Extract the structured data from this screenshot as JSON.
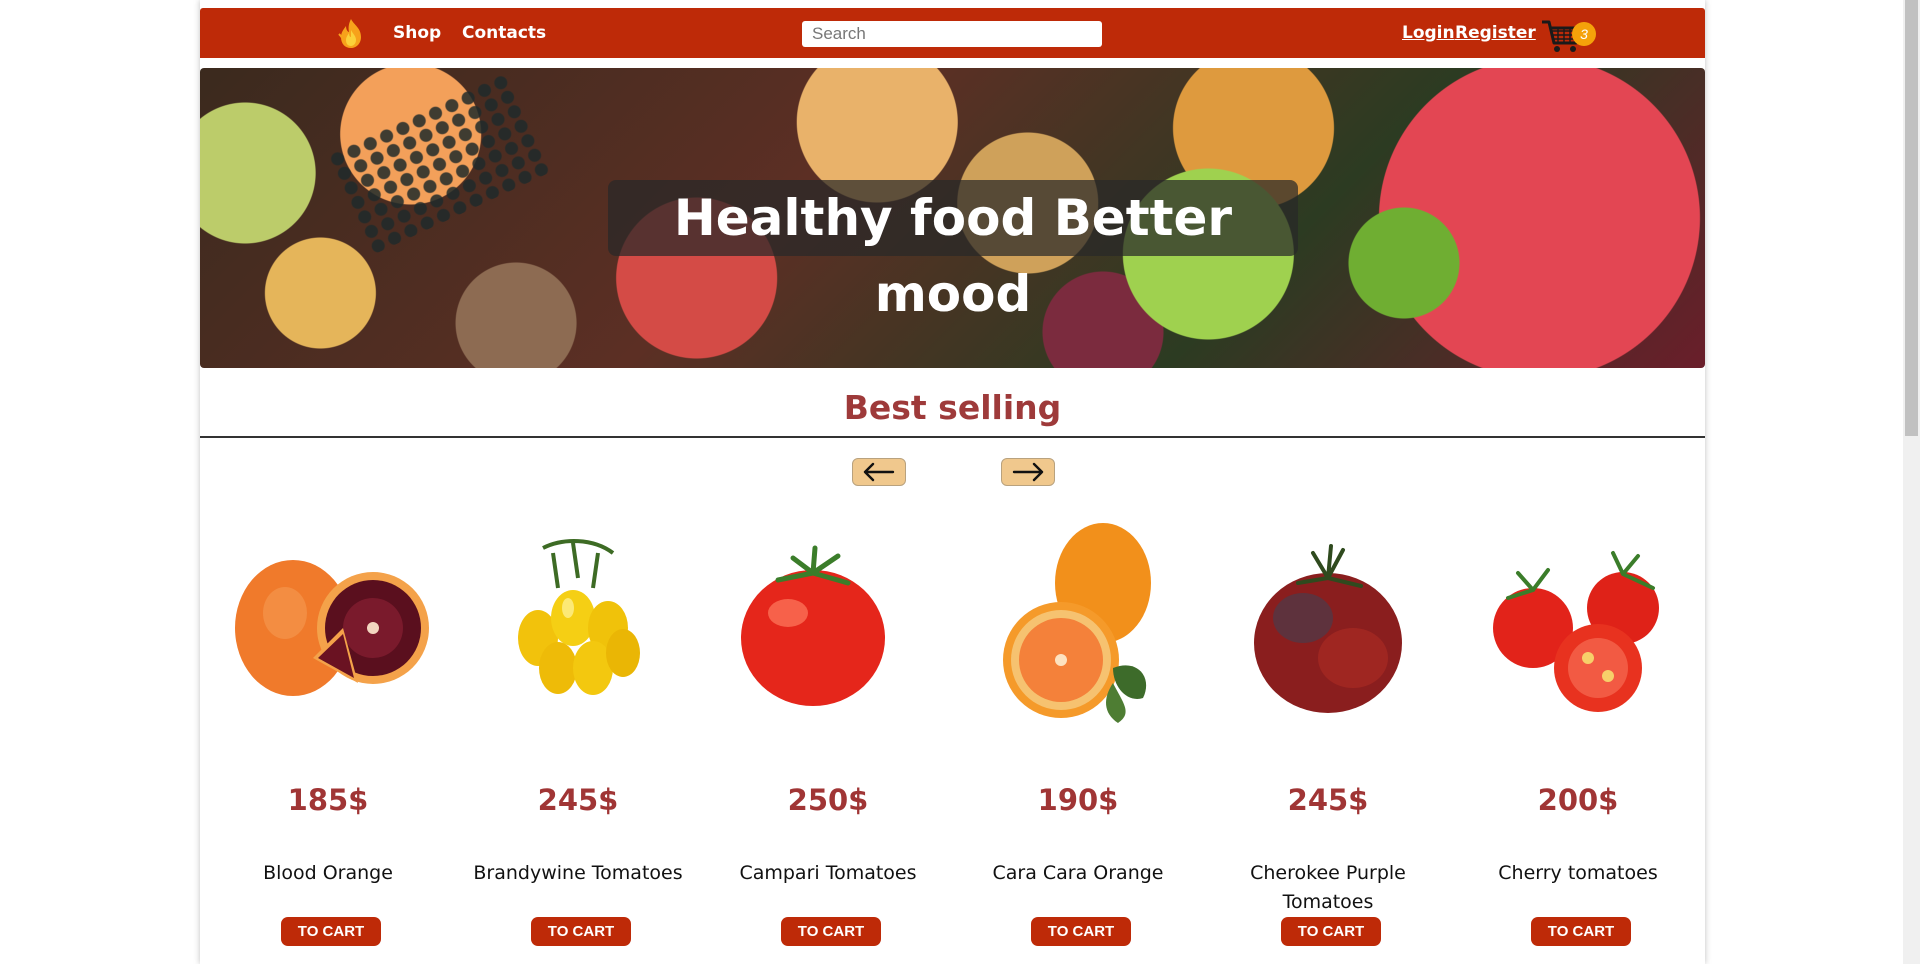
{
  "nav": {
    "logo_icon": "fire-logo-icon",
    "shop_label": "Shop",
    "contacts_label": "Contacts",
    "search_placeholder": "Search",
    "login_label": "Login",
    "register_label": "Register",
    "cart_icon": "shopping-cart-icon",
    "cart_count": "3"
  },
  "hero": {
    "caption": "Healthy food Better mood"
  },
  "section": {
    "title": "Best selling",
    "prev_icon": "arrow-left-icon",
    "next_icon": "arrow-right-icon"
  },
  "products": [
    {
      "name": "Blood Orange",
      "price": "185$",
      "button": "TO CART"
    },
    {
      "name": "Brandywine Tomatoes",
      "price": "245$",
      "button": "TO CART"
    },
    {
      "name": "Campari Tomatoes",
      "price": "250$",
      "button": "TO CART"
    },
    {
      "name": "Cara Cara Orange",
      "price": "190$",
      "button": "TO CART"
    },
    {
      "name": "Cherokee Purple Tomatoes",
      "price": "245$",
      "button": "TO CART"
    },
    {
      "name": "Cherry tomatoes",
      "price": "200$",
      "button": "TO CART"
    }
  ],
  "colors": {
    "brand": "#be2a08",
    "price": "#a03535",
    "title": "#9e3a3a",
    "badge": "#f5a20a",
    "arrow_button": "#f0c88d"
  }
}
